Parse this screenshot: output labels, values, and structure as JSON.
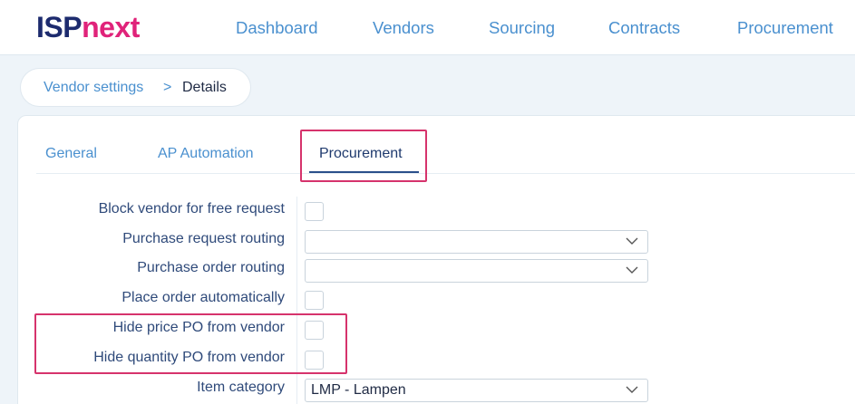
{
  "brand": {
    "logo_part1": "ISP",
    "logo_part2": "next"
  },
  "nav": {
    "items": [
      "Dashboard",
      "Vendors",
      "Sourcing",
      "Contracts",
      "Procurement"
    ]
  },
  "breadcrumb": {
    "parent": "Vendor settings",
    "separator": ">",
    "current": "Details"
  },
  "tabs": {
    "general": "General",
    "ap_automation": "AP Automation",
    "procurement": "Procurement",
    "active": "Procurement"
  },
  "form": {
    "block_vendor_free_request": {
      "label": "Block vendor for free request",
      "checked": false
    },
    "purchase_request_routing": {
      "label": "Purchase request routing",
      "value": ""
    },
    "purchase_order_routing": {
      "label": "Purchase order routing",
      "value": ""
    },
    "place_order_automatically": {
      "label": "Place order automatically",
      "checked": false
    },
    "hide_price_po": {
      "label": "Hide price PO from vendor",
      "checked": false
    },
    "hide_quantity_po": {
      "label": "Hide quantity PO from vendor",
      "checked": false
    },
    "item_category": {
      "label": "Item category",
      "value": "LMP - Lampen"
    }
  },
  "colors": {
    "accent": "#4a90cf",
    "brand_dark": "#1d2b6e",
    "brand_pink": "#e0237a",
    "highlight": "#d6336c"
  }
}
